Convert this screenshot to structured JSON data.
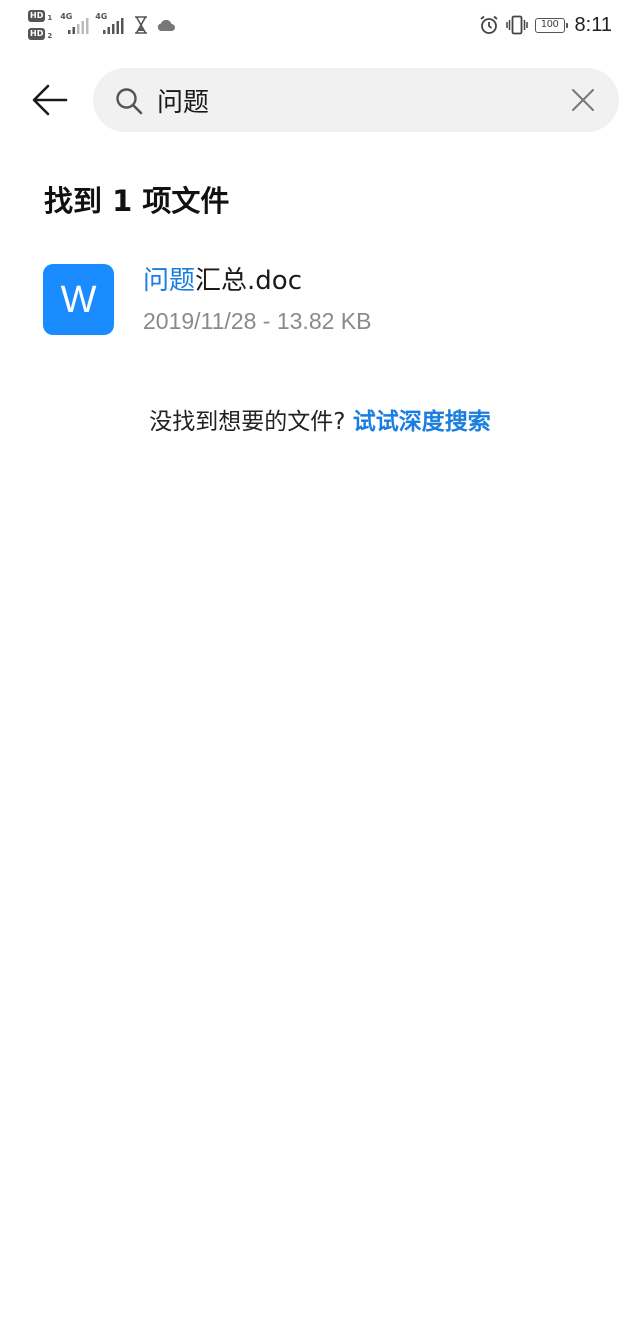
{
  "status_bar": {
    "sim1_badge": "HD",
    "sim1_num": "1",
    "sim2_badge": "HD",
    "sim2_num": "2",
    "network1": "4G",
    "network2": "4G",
    "battery_level": "100",
    "time": "8:11",
    "icons": [
      "hourglass-icon",
      "cloud-icon",
      "alarm-icon",
      "vibrate-icon",
      "battery-icon"
    ]
  },
  "search": {
    "query": "问题",
    "back_icon": "arrow-left-icon",
    "search_icon": "search-icon",
    "clear_icon": "close-icon"
  },
  "results": {
    "heading": "找到 1 项文件",
    "items": [
      {
        "icon_letter": "W",
        "icon_color": "#1a8cff",
        "name_highlight": "问题",
        "name_rest": "汇总.doc",
        "meta": "2019/11/28 - 13.82 KB"
      }
    ]
  },
  "deep_search": {
    "prompt": "没找到想要的文件?",
    "link": "试试深度搜索"
  },
  "colors": {
    "accent": "#1a7de0",
    "search_bg": "#f1f1f1",
    "meta_text": "#8a8a8a"
  }
}
